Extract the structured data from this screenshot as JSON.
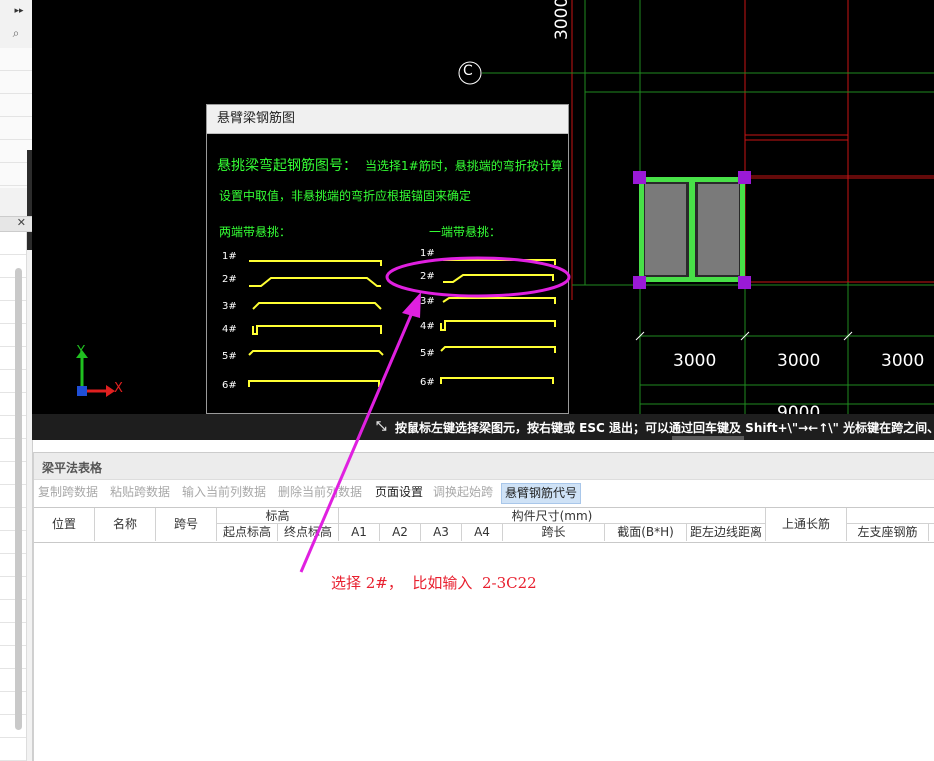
{
  "cad": {
    "dimensions": {
      "top_vertical": "3000",
      "d1": "3000",
      "d2": "3000",
      "d3": "3000",
      "total": "9000"
    },
    "axis_label_c": "C",
    "ucs": {
      "x": "X",
      "y": "Y"
    },
    "colors": {
      "background": "#000000",
      "grid_red": "#c81414",
      "grid_green": "#1f8a1f",
      "column_fill": "#7a7a7a",
      "column_border": "#48e048",
      "grip": "#9a1ad6"
    }
  },
  "dialog": {
    "title": "悬臂梁钢筋图",
    "heading": "悬挑梁弯起钢筋图号：",
    "note_line1": "当选择1#筋时，悬挑端的弯折按计算",
    "note_line2": "设置中取值，非悬挑端的弯折应根据锚固来确定",
    "both_ends_label": "两端带悬挑：",
    "one_end_label": "一端带悬挑：",
    "both_ends": [
      "1#",
      "2#",
      "3#",
      "4#",
      "5#",
      "6#"
    ],
    "one_end": [
      "1#",
      "2#",
      "3#",
      "4#",
      "5#",
      "6#"
    ]
  },
  "statusbar": {
    "icon": "crosshair-icon",
    "text": "按鼠标左键选择梁图元，按右键或 ESC 退出；可以通过回车键及 Shift+\\\"→←↑\\\" 光标键在跨之间、"
  },
  "panel": {
    "title": "梁平法表格",
    "toolbar": [
      {
        "label": "复制跨数据",
        "enabled": false
      },
      {
        "label": "粘贴跨数据",
        "enabled": false
      },
      {
        "label": "输入当前列数据",
        "enabled": false
      },
      {
        "label": "删除当前列数据",
        "enabled": false
      },
      {
        "label": "页面设置",
        "enabled": true
      },
      {
        "label": "调换起始跨",
        "enabled": false
      },
      {
        "label": "悬臂钢筋代号",
        "enabled": true,
        "selected": true
      }
    ],
    "columns": {
      "position": "位置",
      "name": "名称",
      "span_no": "跨号",
      "elevation": "标高",
      "elev_start": "起点标高",
      "elev_end": "终点标高",
      "dims": "构件尺寸(mm)",
      "a1": "A1",
      "a2": "A2",
      "a3": "A3",
      "a4": "A4",
      "span_len": "跨长",
      "section": "截面(B*H)",
      "left_edge_dist": "距左边线距离",
      "top_through": "上通长筋",
      "left_support": "左支座钢筋"
    }
  },
  "annotation": {
    "text": "选择 2#，  比如输入  2-3C22",
    "color": "#e8202f",
    "arrow_color": "#e020e0"
  }
}
